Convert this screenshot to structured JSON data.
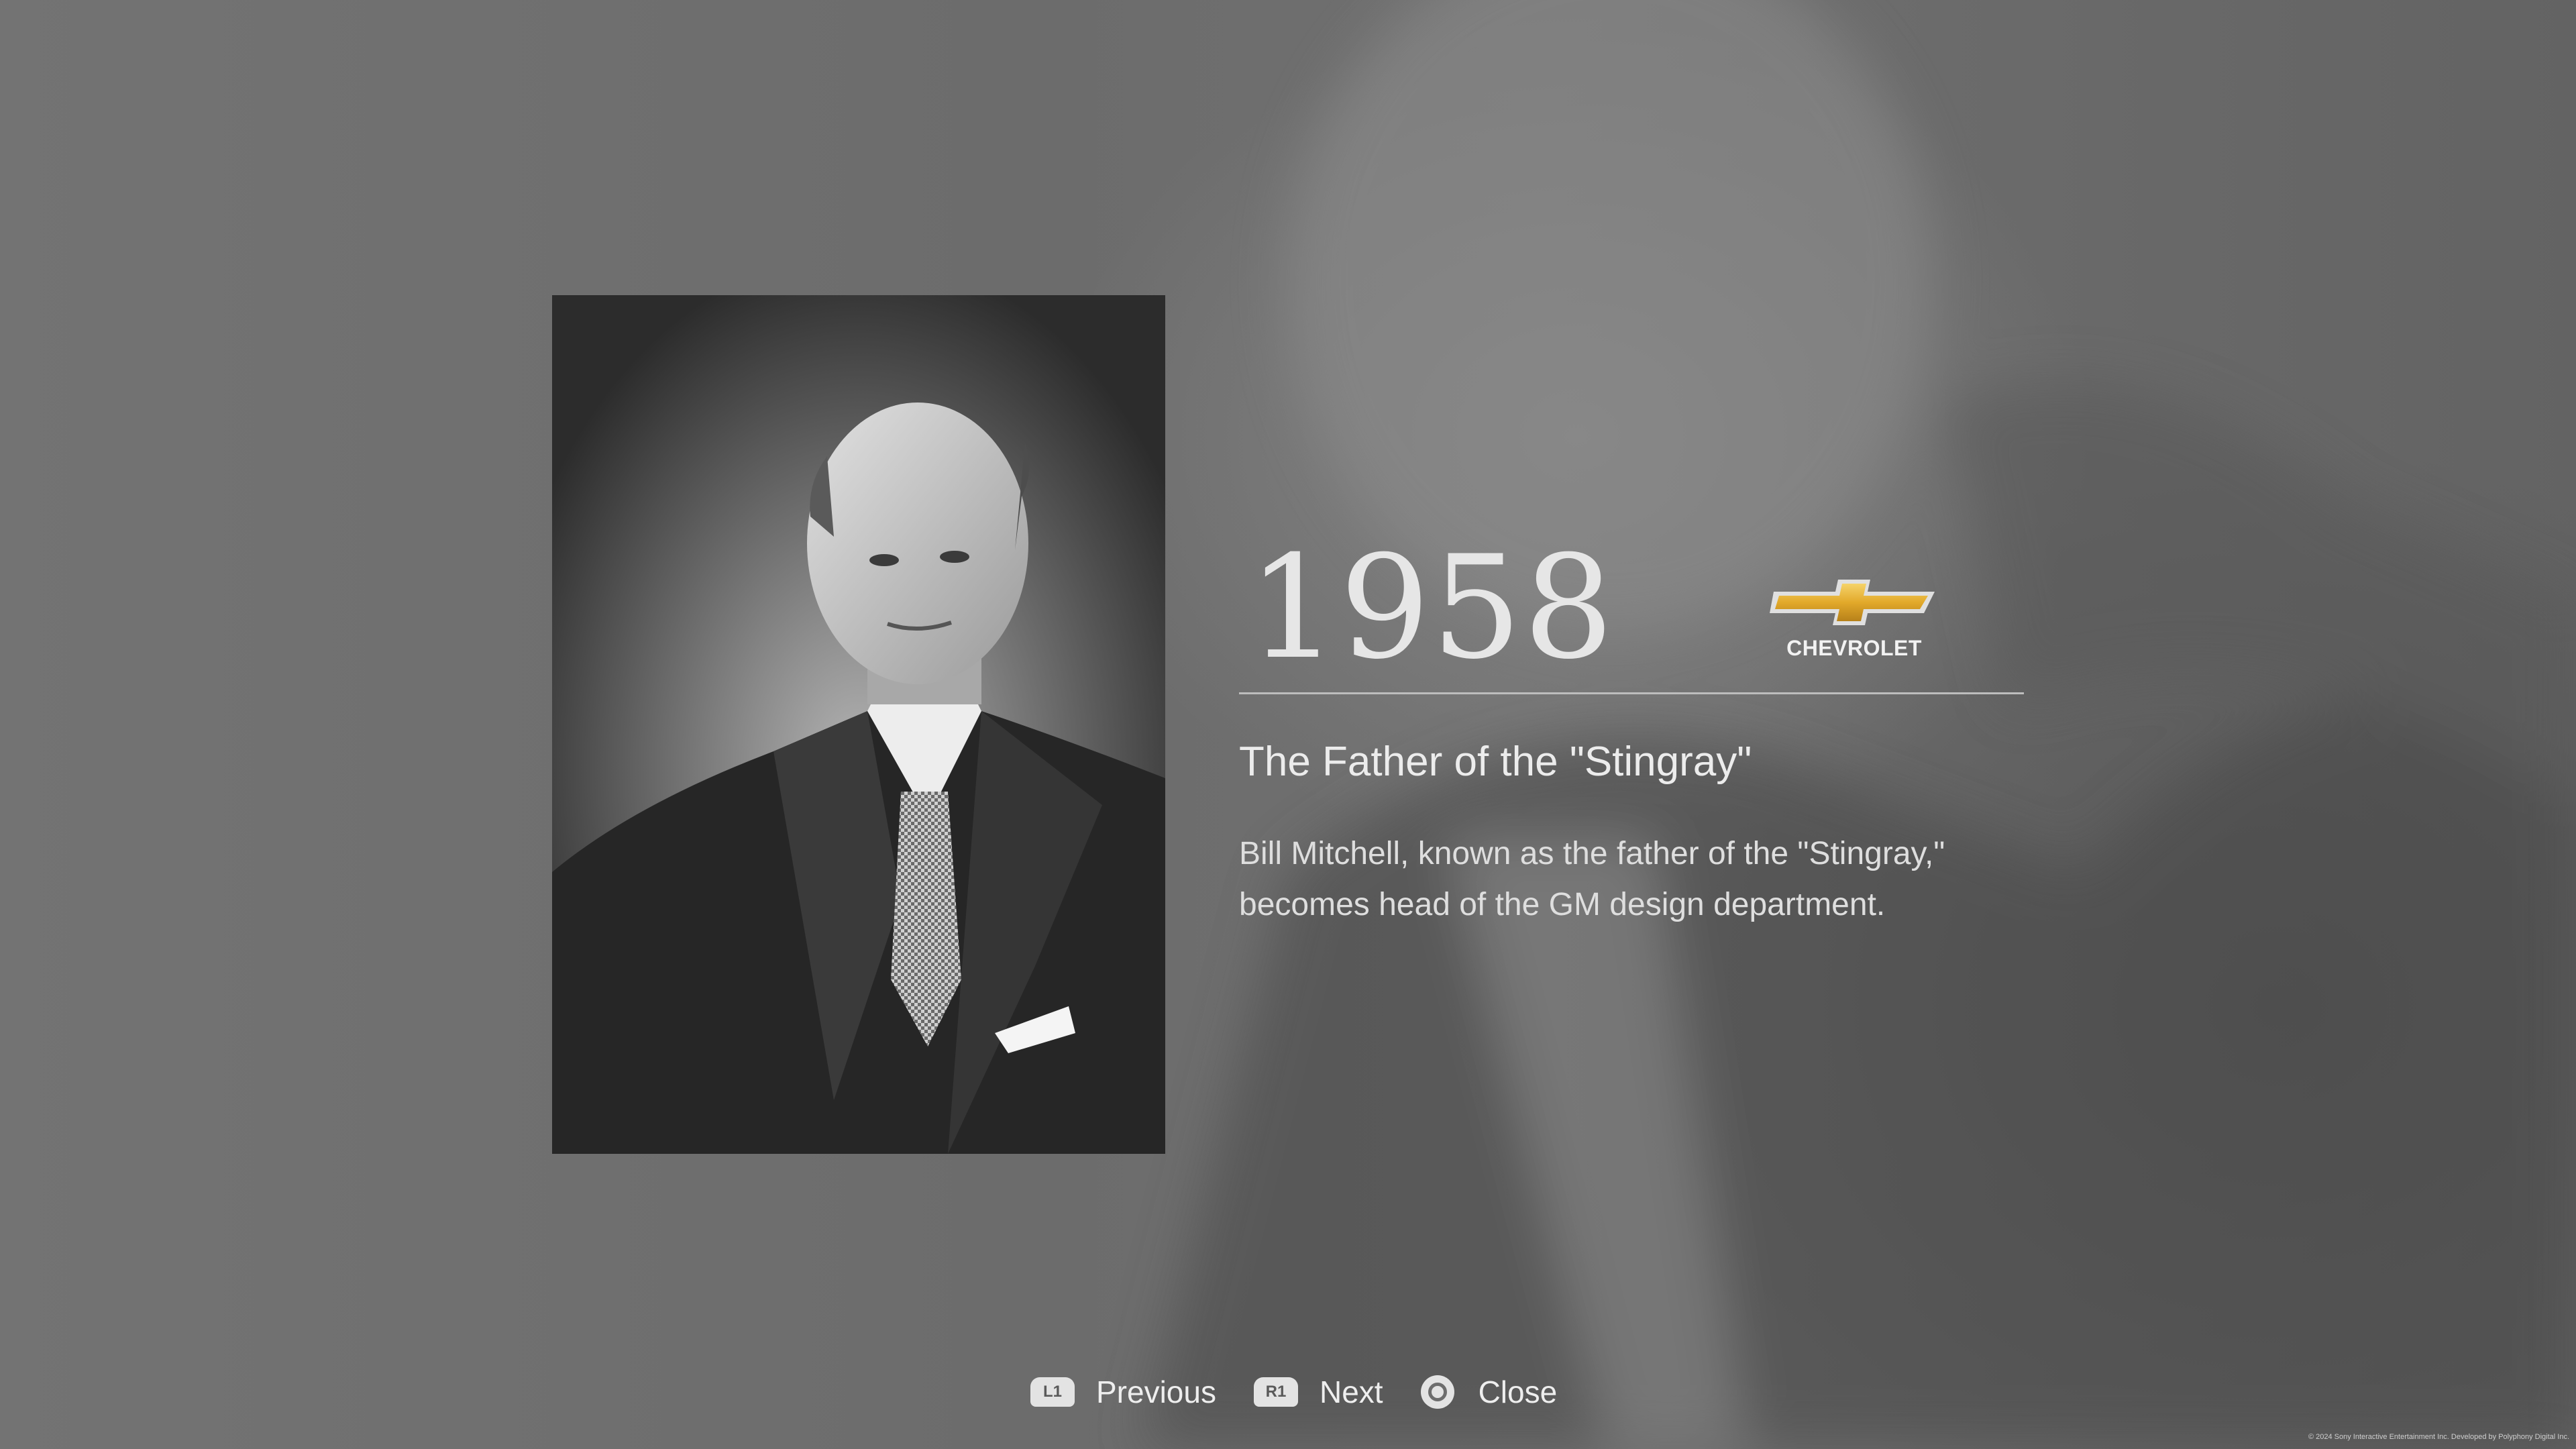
{
  "timeline_entry": {
    "year": "1958",
    "brand": {
      "name": "CHEVROLET",
      "logo_icon": "chevrolet-bowtie-icon",
      "accent_color": "#e8b73a"
    },
    "headline": "The Father of the \"Stingray\"",
    "description": "Bill Mitchell, known as the father of the \"Stingray,\" becomes head of the GM design department.",
    "photo_icon": "portrait-photo"
  },
  "controls": {
    "previous": {
      "button": "L1",
      "label": "Previous"
    },
    "next": {
      "button": "R1",
      "label": "Next"
    },
    "close": {
      "button_icon": "circle-button-icon",
      "label": "Close"
    }
  },
  "footer": {
    "copyright": "© 2024 Sony Interactive Entertainment Inc. Developed by Polyphony Digital Inc."
  }
}
